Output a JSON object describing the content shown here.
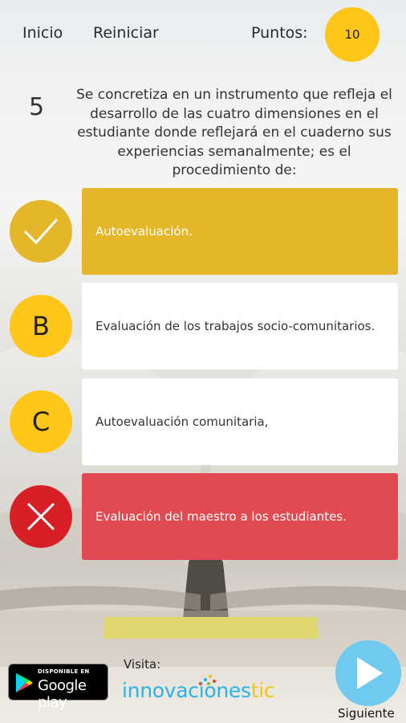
{
  "header": {
    "inicio_label": "Inicio",
    "reiniciar_label": "Reiniciar",
    "puntos_label": "Puntos:",
    "score": "10"
  },
  "question": {
    "number": "5",
    "text": "Se concretiza en un instrumento que refleja el desarrollo de las cuatro dimensiones en el estudiante donde reflejará en el cuaderno sus experiencias semanalmente; es el procedimiento de:"
  },
  "options": [
    {
      "marker": "check-icon",
      "text": "Autoevaluación.",
      "state": "correct"
    },
    {
      "marker": "B",
      "text": "Evaluación de los trabajos socio-comunitarios.",
      "state": "neutral"
    },
    {
      "marker": "C",
      "text": "Autoevaluación comunitaria,",
      "state": "neutral"
    },
    {
      "marker": "cross-icon",
      "text": "Evaluación del maestro a los estudiantes.",
      "state": "wrong"
    }
  ],
  "footer": {
    "gplay_small": "DISPONIBLE EN",
    "gplay_big": "Google play",
    "visita_label": "Visita:",
    "brand_main": "innovaciones",
    "brand_tic": "tic",
    "next_label": "Siguiente"
  },
  "colors": {
    "yellow": "#ffc61a",
    "correct": "#e4b72b",
    "wrong": "#e04a50",
    "wrong_circle": "#d91f26",
    "next": "#6fcaee",
    "brand_blue": "#2ab3e6",
    "brand_yellow": "#f0c419"
  }
}
